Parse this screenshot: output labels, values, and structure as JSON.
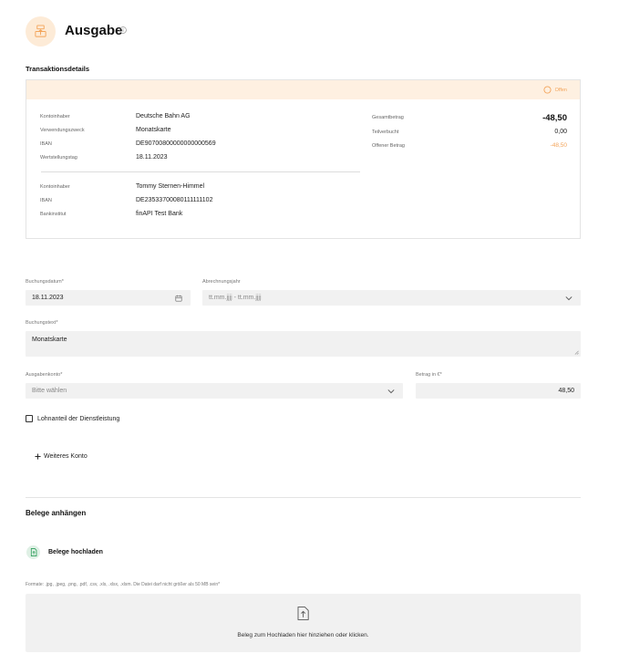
{
  "header": {
    "title": "Ausgabe",
    "icon": "register-icon",
    "info_icon": "info-icon"
  },
  "transaction": {
    "section_title": "Transaktionsdetails",
    "status": "Offen",
    "payee": [
      {
        "label": "Kontoinhaber",
        "value": "Deutsche Bahn AG"
      },
      {
        "label": "Verwendungszweck",
        "value": "Monatskarte"
      },
      {
        "label": "IBAN",
        "value": "DE90700800000000000569"
      },
      {
        "label": "Wertstellungstag",
        "value": "18.11.2023"
      }
    ],
    "payer": [
      {
        "label": "Kontoinhaber",
        "value": "Tommy Sternen-Himmel"
      },
      {
        "label": "IBAN",
        "value": "DE23533700080111111102"
      },
      {
        "label": "Bankinstitut",
        "value": "finAPI Test Bank"
      }
    ],
    "amounts": [
      {
        "label": "Gesamtbetrag",
        "value": "-48,50"
      },
      {
        "label": "Teilverbucht",
        "value": "0,00"
      },
      {
        "label": "Offener Betrag",
        "value": "-48,50"
      }
    ]
  },
  "form": {
    "booking_date_label": "Buchungsdatum*",
    "booking_date_value": "18.11.2023",
    "billing_year_label": "Abrechnungsjahr",
    "billing_year_placeholder": "tt.mm.jjjj - tt.mm.jjjj",
    "booking_text_label": "Buchungstext*",
    "booking_text_value": "Monatskarte",
    "expense_account_label": "Ausgabenkonto*",
    "expense_account_placeholder": "Bitte wählen",
    "amount_label": "Betrag in €*",
    "amount_value": "48,50",
    "checkbox_label": "Lohnanteil der Dienstleistung",
    "checkbox_checked": false,
    "add_account_label": "Weiteres Konto"
  },
  "attachments": {
    "title": "Belege anhängen",
    "upload_button": "Belege hochladen",
    "formats_note": "Formate: .jpg, .jpeg, .png, .pdf, .csv, .xls, .xlsx, .xlsm. Die Datei darf nicht größer als 50 MB sein*",
    "dropzone_text": "Beleg zum Hochladen hier hinziehen oder klicken."
  },
  "colors": {
    "accent_orange": "#f3a45a",
    "band": "#fef0e1",
    "field_bg": "#f1f1f1",
    "upload_green": "#2e9e5b"
  }
}
